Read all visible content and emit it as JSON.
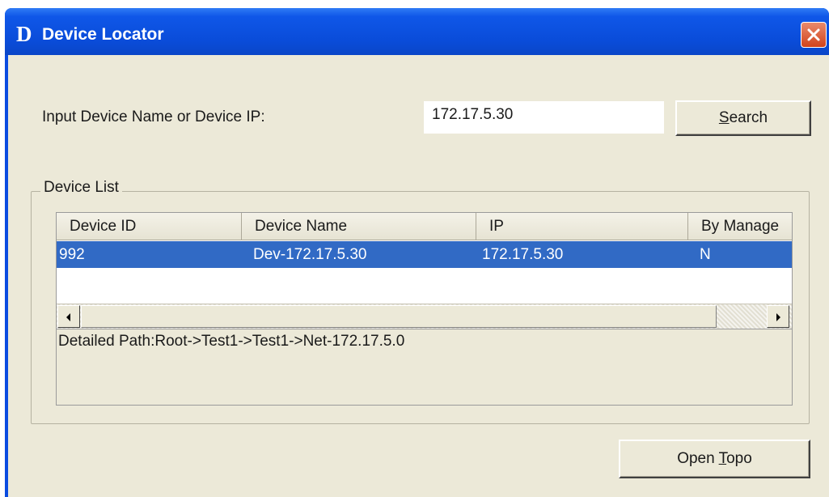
{
  "window": {
    "app_icon_glyph": "D",
    "title": "Device Locator"
  },
  "search": {
    "label": "Input Device Name or Device IP:",
    "value": "172.17.5.30",
    "button": {
      "mnemonic": "S",
      "rest": "earch"
    }
  },
  "device_list": {
    "group_title": "Device List",
    "columns": [
      "Device ID",
      "Device Name",
      "IP",
      "By Manage"
    ],
    "rows": [
      {
        "device_id": "992",
        "device_name": "Dev-172.17.5.30",
        "ip": "172.17.5.30",
        "by_manage": "N"
      }
    ],
    "detailed_path": "Detailed Path:Root->Test1->Test1->Net-172.17.5.0"
  },
  "footer": {
    "open_topo": {
      "prefix": "Open ",
      "mnemonic": "T",
      "rest": "opo"
    }
  },
  "icons": {
    "close": "close-icon",
    "scroll_left": "arrow-left-icon",
    "scroll_right": "arrow-right-icon"
  },
  "colors": {
    "titlebar": "#0a4ce0",
    "client": "#ece9d8",
    "selection": "#316ac5",
    "close_button": "#d2431c"
  }
}
